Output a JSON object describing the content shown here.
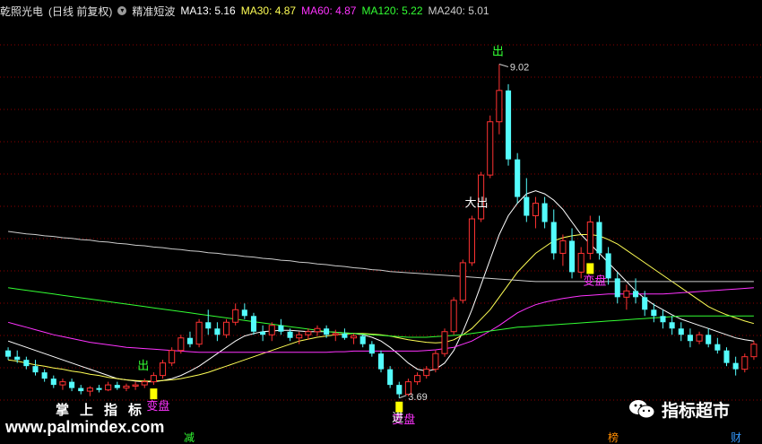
{
  "header": {
    "stock": "乾照光电",
    "period": "(日线 前复权)",
    "indicator": "精准短波",
    "ma": [
      {
        "label": "MA13:",
        "value": "5.16",
        "color": "#ffffff"
      },
      {
        "label": "MA30:",
        "value": "4.87",
        "color": "#ffff55"
      },
      {
        "label": "MA60:",
        "value": "4.87",
        "color": "#ff33ff"
      },
      {
        "label": "MA120:",
        "value": "5.22",
        "color": "#33ff33"
      },
      {
        "label": "MA240:",
        "value": "5.01",
        "color": "#cccccc"
      }
    ]
  },
  "colors": {
    "up": "#ff3232",
    "down": "#54fcfc",
    "grid": "#8b0000",
    "bg": "#000000",
    "signal": "#ffff00"
  },
  "chart_data": {
    "type": "candlestick",
    "ylim": [
      3.2,
      9.7
    ],
    "high_label": "9.02",
    "low_label": "3.69",
    "candles": [
      [
        4.45,
        4.5,
        4.3,
        4.35
      ],
      [
        4.35,
        4.45,
        4.25,
        4.3
      ],
      [
        4.3,
        4.35,
        4.15,
        4.2
      ],
      [
        4.2,
        4.3,
        4.05,
        4.1
      ],
      [
        4.1,
        4.15,
        3.95,
        4.0
      ],
      [
        4.0,
        4.05,
        3.85,
        3.9
      ],
      [
        3.9,
        4.0,
        3.82,
        3.95
      ],
      [
        3.95,
        4.0,
        3.8,
        3.85
      ],
      [
        3.85,
        3.9,
        3.75,
        3.8
      ],
      [
        3.8,
        3.88,
        3.72,
        3.85
      ],
      [
        3.85,
        3.9,
        3.78,
        3.82
      ],
      [
        3.82,
        3.95,
        3.8,
        3.9
      ],
      [
        3.9,
        3.95,
        3.82,
        3.85
      ],
      [
        3.85,
        3.92,
        3.8,
        3.88
      ],
      [
        3.88,
        3.95,
        3.82,
        3.9
      ],
      [
        3.9,
        4.0,
        3.85,
        3.95
      ],
      [
        3.95,
        4.1,
        3.9,
        4.05
      ],
      [
        4.05,
        4.3,
        4.0,
        4.25
      ],
      [
        4.25,
        4.5,
        4.2,
        4.45
      ],
      [
        4.45,
        4.7,
        4.4,
        4.65
      ],
      [
        4.65,
        4.75,
        4.5,
        4.55
      ],
      [
        4.55,
        4.95,
        4.5,
        4.9
      ],
      [
        4.9,
        5.1,
        4.7,
        4.8
      ],
      [
        4.8,
        4.9,
        4.6,
        4.7
      ],
      [
        4.7,
        4.95,
        4.65,
        4.9
      ],
      [
        4.9,
        5.2,
        4.85,
        5.1
      ],
      [
        5.1,
        5.2,
        4.95,
        5.0
      ],
      [
        5.0,
        5.05,
        4.7,
        4.75
      ],
      [
        4.75,
        4.85,
        4.6,
        4.7
      ],
      [
        4.7,
        4.9,
        4.6,
        4.85
      ],
      [
        4.85,
        4.95,
        4.7,
        4.75
      ],
      [
        4.75,
        4.8,
        4.6,
        4.65
      ],
      [
        4.65,
        4.75,
        4.55,
        4.7
      ],
      [
        4.7,
        4.8,
        4.62,
        4.75
      ],
      [
        4.75,
        4.85,
        4.68,
        4.8
      ],
      [
        4.8,
        4.85,
        4.65,
        4.7
      ],
      [
        4.7,
        4.78,
        4.6,
        4.72
      ],
      [
        4.72,
        4.8,
        4.62,
        4.65
      ],
      [
        4.65,
        4.72,
        4.55,
        4.68
      ],
      [
        4.68,
        4.7,
        4.5,
        4.55
      ],
      [
        4.55,
        4.6,
        4.35,
        4.4
      ],
      [
        4.4,
        4.45,
        4.1,
        4.15
      ],
      [
        4.15,
        4.2,
        3.85,
        3.9
      ],
      [
        3.9,
        3.95,
        3.69,
        3.75
      ],
      [
        3.75,
        4.0,
        3.72,
        3.95
      ],
      [
        3.95,
        4.1,
        3.9,
        4.05
      ],
      [
        4.05,
        4.2,
        4.0,
        4.15
      ],
      [
        4.15,
        4.45,
        4.1,
        4.4
      ],
      [
        4.4,
        4.8,
        4.35,
        4.75
      ],
      [
        4.75,
        5.3,
        4.7,
        5.25
      ],
      [
        5.25,
        5.9,
        5.2,
        5.85
      ],
      [
        5.85,
        6.6,
        5.8,
        6.55
      ],
      [
        6.55,
        7.3,
        6.5,
        7.25
      ],
      [
        7.25,
        8.2,
        7.2,
        8.1
      ],
      [
        8.1,
        9.02,
        7.9,
        8.6
      ],
      [
        8.6,
        8.7,
        7.4,
        7.5
      ],
      [
        7.5,
        7.6,
        6.8,
        6.9
      ],
      [
        6.9,
        7.2,
        6.5,
        6.6
      ],
      [
        6.6,
        6.9,
        6.4,
        6.8
      ],
      [
        6.8,
        6.9,
        6.4,
        6.5
      ],
      [
        6.5,
        6.7,
        5.9,
        6.0
      ],
      [
        6.0,
        6.3,
        5.8,
        6.2
      ],
      [
        6.2,
        6.4,
        5.6,
        5.7
      ],
      [
        5.7,
        6.1,
        5.6,
        6.0
      ],
      [
        6.0,
        6.6,
        5.9,
        6.5
      ],
      [
        6.5,
        6.6,
        5.9,
        6.0
      ],
      [
        6.0,
        6.1,
        5.5,
        5.6
      ],
      [
        5.6,
        5.7,
        5.2,
        5.3
      ],
      [
        5.3,
        5.5,
        5.1,
        5.4
      ],
      [
        5.4,
        5.6,
        5.2,
        5.3
      ],
      [
        5.3,
        5.4,
        5.0,
        5.1
      ],
      [
        5.1,
        5.2,
        4.9,
        5.0
      ],
      [
        5.0,
        5.1,
        4.8,
        4.9
      ],
      [
        4.9,
        5.0,
        4.7,
        4.8
      ],
      [
        4.8,
        4.9,
        4.6,
        4.7
      ],
      [
        4.7,
        4.8,
        4.5,
        4.6
      ],
      [
        4.6,
        4.75,
        4.55,
        4.7
      ],
      [
        4.7,
        4.8,
        4.5,
        4.55
      ],
      [
        4.55,
        4.65,
        4.4,
        4.45
      ],
      [
        4.45,
        4.5,
        4.2,
        4.25
      ],
      [
        4.25,
        4.35,
        4.05,
        4.15
      ],
      [
        4.15,
        4.4,
        4.1,
        4.35
      ],
      [
        4.35,
        4.6,
        4.3,
        4.55
      ]
    ],
    "ma_lines": [
      {
        "name": "MA13",
        "color": "#ffffff",
        "values": [
          4.6,
          4.55,
          4.5,
          4.45,
          4.4,
          4.35,
          4.3,
          4.25,
          4.2,
          4.15,
          4.1,
          4.05,
          4.0,
          3.98,
          3.96,
          3.95,
          3.95,
          3.97,
          4.0,
          4.05,
          4.12,
          4.2,
          4.3,
          4.4,
          4.5,
          4.6,
          4.68,
          4.72,
          4.75,
          4.76,
          4.77,
          4.77,
          4.76,
          4.75,
          4.75,
          4.75,
          4.74,
          4.73,
          4.72,
          4.7,
          4.66,
          4.6,
          4.5,
          4.38,
          4.25,
          4.15,
          4.12,
          4.15,
          4.25,
          4.45,
          4.75,
          5.1,
          5.5,
          5.9,
          6.3,
          6.6,
          6.8,
          6.95,
          7.0,
          6.95,
          6.85,
          6.7,
          6.5,
          6.3,
          6.15,
          6.0,
          5.85,
          5.7,
          5.55,
          5.4,
          5.28,
          5.18,
          5.1,
          5.02,
          4.95,
          4.9,
          4.85,
          4.8,
          4.75,
          4.7,
          4.65,
          4.62,
          4.6
        ]
      },
      {
        "name": "MA30",
        "color": "#ffff55",
        "values": [
          4.3,
          4.28,
          4.25,
          4.22,
          4.2,
          4.17,
          4.15,
          4.12,
          4.1,
          4.07,
          4.05,
          4.02,
          4.0,
          3.98,
          3.97,
          3.96,
          3.96,
          3.97,
          3.98,
          4.0,
          4.03,
          4.06,
          4.1,
          4.15,
          4.2,
          4.25,
          4.3,
          4.35,
          4.4,
          4.45,
          4.5,
          4.55,
          4.6,
          4.63,
          4.66,
          4.68,
          4.7,
          4.71,
          4.72,
          4.72,
          4.71,
          4.7,
          4.68,
          4.65,
          4.62,
          4.6,
          4.58,
          4.57,
          4.58,
          4.62,
          4.7,
          4.8,
          4.95,
          5.1,
          5.3,
          5.5,
          5.7,
          5.85,
          6.0,
          6.1,
          6.2,
          6.25,
          6.28,
          6.3,
          6.3,
          6.28,
          6.22,
          6.15,
          6.05,
          5.95,
          5.85,
          5.75,
          5.65,
          5.55,
          5.45,
          5.35,
          5.25,
          5.15,
          5.08,
          5.02,
          4.97,
          4.92,
          4.88
        ]
      },
      {
        "name": "MA60",
        "color": "#ff33ff",
        "values": [
          4.9,
          4.86,
          4.82,
          4.78,
          4.74,
          4.7,
          4.67,
          4.64,
          4.61,
          4.58,
          4.56,
          4.54,
          4.52,
          4.5,
          4.49,
          4.48,
          4.47,
          4.46,
          4.45,
          4.44,
          4.43,
          4.42,
          4.42,
          4.42,
          4.42,
          4.42,
          4.42,
          4.42,
          4.42,
          4.42,
          4.42,
          4.42,
          4.42,
          4.42,
          4.42,
          4.42,
          4.43,
          4.43,
          4.44,
          4.44,
          4.44,
          4.44,
          4.44,
          4.44,
          4.44,
          4.44,
          4.45,
          4.46,
          4.48,
          4.5,
          4.55,
          4.6,
          4.68,
          4.76,
          4.85,
          4.95,
          5.05,
          5.12,
          5.18,
          5.22,
          5.25,
          5.28,
          5.3,
          5.32,
          5.33,
          5.34,
          5.35,
          5.35,
          5.35,
          5.35,
          5.35,
          5.35,
          5.35,
          5.36,
          5.37,
          5.38,
          5.39,
          5.4,
          5.41,
          5.42,
          5.43,
          5.44,
          5.45
        ]
      },
      {
        "name": "MA120",
        "color": "#33ff33",
        "values": [
          5.45,
          5.43,
          5.41,
          5.39,
          5.37,
          5.35,
          5.33,
          5.31,
          5.29,
          5.27,
          5.25,
          5.23,
          5.21,
          5.19,
          5.17,
          5.15,
          5.13,
          5.11,
          5.09,
          5.07,
          5.05,
          5.03,
          5.01,
          4.99,
          4.97,
          4.95,
          4.93,
          4.91,
          4.89,
          4.87,
          4.85,
          4.83,
          4.81,
          4.79,
          4.77,
          4.75,
          4.74,
          4.73,
          4.72,
          4.71,
          4.7,
          4.69,
          4.68,
          4.67,
          4.66,
          4.66,
          4.66,
          4.67,
          4.68,
          4.69,
          4.7,
          4.72,
          4.74,
          4.76,
          4.78,
          4.8,
          4.82,
          4.83,
          4.84,
          4.85,
          4.86,
          4.87,
          4.88,
          4.89,
          4.9,
          4.91,
          4.92,
          4.93,
          4.94,
          4.95,
          4.96,
          4.97,
          4.98,
          4.99,
          5.0,
          5.0,
          5.0,
          5.0,
          5.0,
          5.0,
          5.0,
          5.0,
          5.0
        ]
      },
      {
        "name": "MA240",
        "color": "#cccccc",
        "values": [
          6.35,
          6.33,
          6.31,
          6.3,
          6.28,
          6.27,
          6.25,
          6.24,
          6.22,
          6.21,
          6.19,
          6.18,
          6.16,
          6.15,
          6.13,
          6.12,
          6.1,
          6.09,
          6.07,
          6.06,
          6.04,
          6.03,
          6.01,
          6.0,
          5.98,
          5.97,
          5.95,
          5.94,
          5.92,
          5.91,
          5.89,
          5.88,
          5.86,
          5.85,
          5.83,
          5.82,
          5.8,
          5.79,
          5.77,
          5.76,
          5.74,
          5.73,
          5.71,
          5.7,
          5.69,
          5.68,
          5.67,
          5.66,
          5.65,
          5.64,
          5.63,
          5.62,
          5.61,
          5.6,
          5.59,
          5.58,
          5.57,
          5.56,
          5.55,
          5.55,
          5.55,
          5.55,
          5.55,
          5.55,
          5.55,
          5.55,
          5.55,
          5.55,
          5.55,
          5.55,
          5.55,
          5.55,
          5.55,
          5.55,
          5.55,
          5.55,
          5.55,
          5.55,
          5.55,
          5.55,
          5.55,
          5.55,
          5.55
        ]
      }
    ],
    "signals": [
      {
        "i": 16,
        "text": "变盘",
        "color": "#ff33ff",
        "box": true
      },
      {
        "i": 43,
        "text": "变盘",
        "color": "#ff33ff",
        "box": true
      },
      {
        "i": 43,
        "text": "进",
        "color": "#ffffff",
        "box": false
      },
      {
        "i": 64,
        "text": "变盘",
        "color": "#ff33ff",
        "box": true
      },
      {
        "i": 15,
        "text": "出",
        "color": "#33ff33",
        "box": false
      },
      {
        "i": 54,
        "text": "出",
        "color": "#33ff33",
        "box": false
      },
      {
        "i": 51,
        "text": "大出",
        "color": "#ffffff",
        "box": false
      }
    ]
  },
  "footer": {
    "brand": "掌上指标",
    "url": "www.palmindex.com",
    "wechat": "指标超市",
    "tabs": [
      {
        "label": "减",
        "color": "#33ff33"
      },
      {
        "label": "榜",
        "color": "#ff8c00"
      },
      {
        "label": "财",
        "color": "#3399ff"
      }
    ]
  }
}
